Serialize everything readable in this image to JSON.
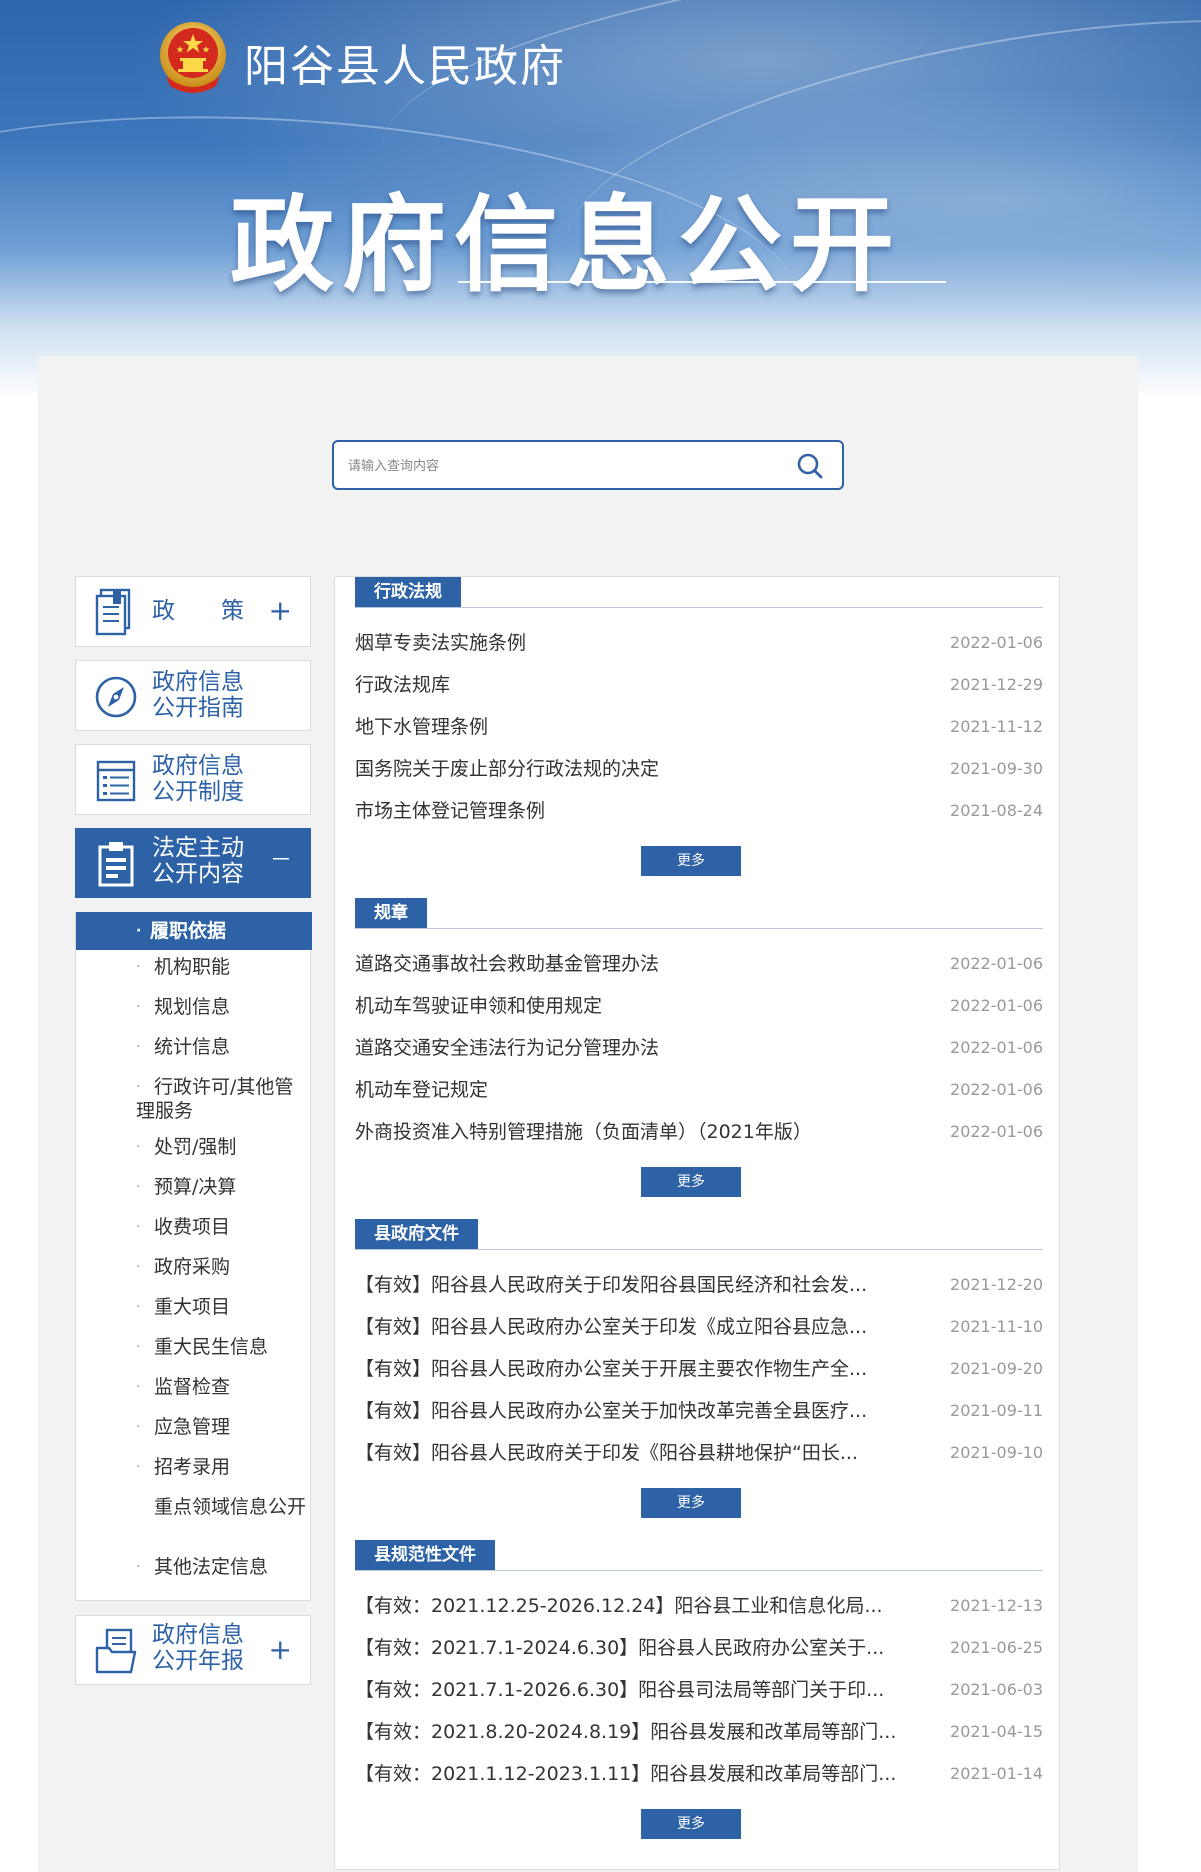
{
  "header": {
    "site_name": "阳谷县人民政府",
    "banner_title": "政府信息公开"
  },
  "search": {
    "placeholder": "请输入查询内容"
  },
  "sidebar": {
    "menus": [
      {
        "label_line1": "政　　策",
        "label_line2": "",
        "toggle": "+"
      },
      {
        "label_line1": "政府信息",
        "label_line2": "公开指南",
        "toggle": ""
      },
      {
        "label_line1": "政府信息",
        "label_line2": "公开制度",
        "toggle": ""
      },
      {
        "label_line1": "法定主动",
        "label_line2": "公开内容",
        "toggle": "－"
      },
      {
        "label_line1": "政府信息",
        "label_line2": "公开年报",
        "toggle": "+"
      }
    ],
    "sub_items": [
      "履职依据",
      "机构职能",
      "规划信息",
      "统计信息",
      "行政许可/其他管理服务",
      "处罚/强制",
      "预算/决算",
      "收费项目",
      "政府采购",
      "重大项目",
      "重大民生信息",
      "监督检查",
      "应急管理",
      "招考录用",
      "重点领域信息公开",
      "其他法定信息"
    ]
  },
  "sections": [
    {
      "title": "行政法规",
      "more": "更多",
      "rows": [
        {
          "title": "烟草专卖法实施条例",
          "date": "2022-01-06"
        },
        {
          "title": "行政法规库",
          "date": "2021-12-29"
        },
        {
          "title": "地下水管理条例",
          "date": "2021-11-12"
        },
        {
          "title": "国务院关于废止部分行政法规的决定",
          "date": "2021-09-30"
        },
        {
          "title": "市场主体登记管理条例",
          "date": "2021-08-24"
        }
      ]
    },
    {
      "title": "规章",
      "more": "更多",
      "rows": [
        {
          "title": "道路交通事故社会救助基金管理办法",
          "date": "2022-01-06"
        },
        {
          "title": "机动车驾驶证申领和使用规定",
          "date": "2022-01-06"
        },
        {
          "title": "道路交通安全违法行为记分管理办法",
          "date": "2022-01-06"
        },
        {
          "title": "机动车登记规定",
          "date": "2022-01-06"
        },
        {
          "title": "外商投资准入特别管理措施（负面清单）（2021年版）",
          "date": "2022-01-06"
        }
      ]
    },
    {
      "title": "县政府文件",
      "more": "更多",
      "rows": [
        {
          "title": "【有效】阳谷县人民政府关于印发阳谷县国民经济和社会发...",
          "date": "2021-12-20"
        },
        {
          "title": "【有效】阳谷县人民政府办公室关于印发《成立阳谷县应急...",
          "date": "2021-11-10"
        },
        {
          "title": "【有效】阳谷县人民政府办公室关于开展主要农作物生产全...",
          "date": "2021-09-20"
        },
        {
          "title": "【有效】阳谷县人民政府办公室关于加快改革完善全县医疗...",
          "date": "2021-09-11"
        },
        {
          "title": "【有效】阳谷县人民政府关于印发《阳谷县耕地保护“田长...",
          "date": "2021-09-10"
        }
      ]
    },
    {
      "title": "县规范性文件",
      "more": "更多",
      "rows": [
        {
          "title": "【有效：2021.12.25-2026.12.24】阳谷县工业和信息化局...",
          "date": "2021-12-13"
        },
        {
          "title": "【有效：2021.7.1-2024.6.30】阳谷县人民政府办公室关于...",
          "date": "2021-06-25"
        },
        {
          "title": "【有效：2021.7.1-2026.6.30】阳谷县司法局等部门关于印...",
          "date": "2021-06-03"
        },
        {
          "title": "【有效：2021.8.20-2024.8.19】阳谷县发展和改革局等部门...",
          "date": "2021-04-15"
        },
        {
          "title": "【有效：2021.1.12-2023.1.11】阳谷县发展和改革局等部门...",
          "date": "2021-01-14"
        }
      ]
    }
  ]
}
